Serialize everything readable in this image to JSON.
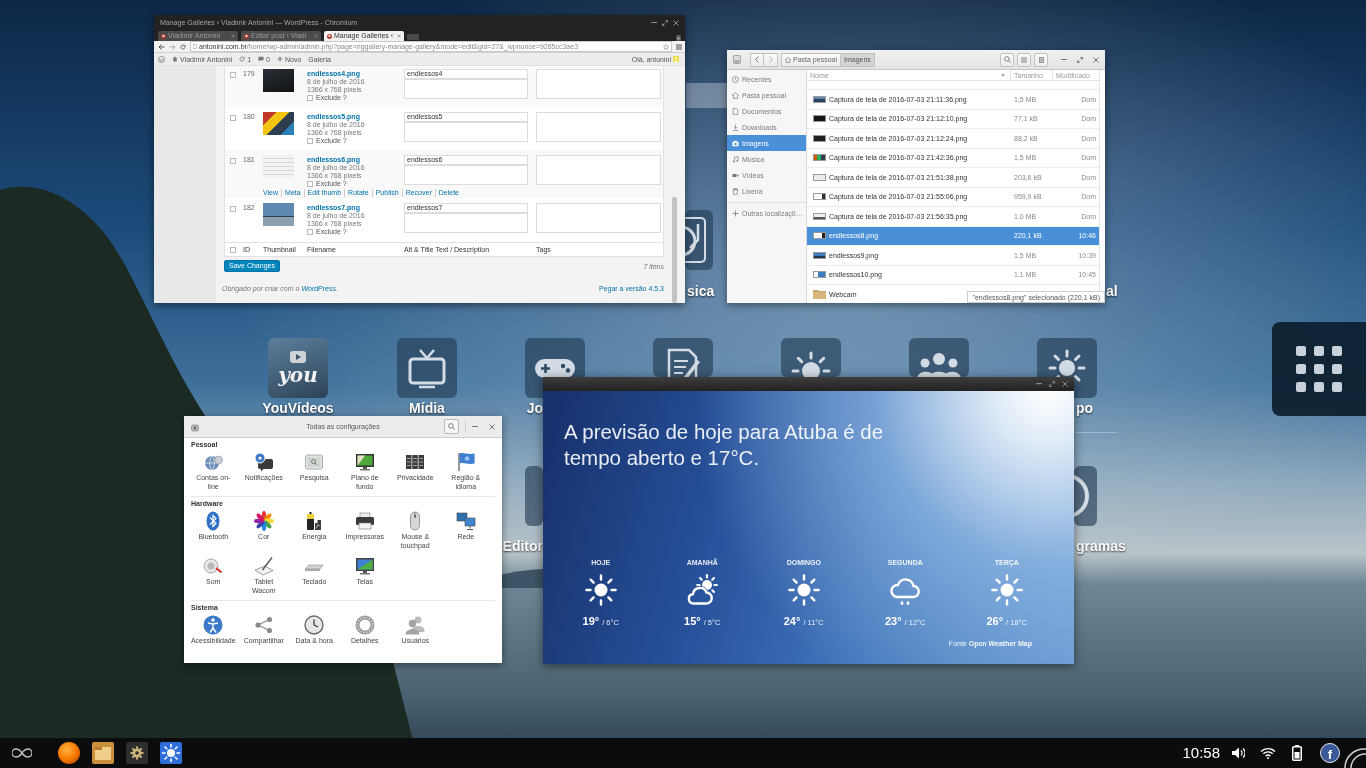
{
  "desktop": {
    "apps": [
      {
        "kind": "disc",
        "label": "sica"
      },
      {
        "kind": "hidden",
        "label": "al"
      },
      {
        "kind": "you",
        "logo": "you",
        "label": "YouVídeos"
      },
      {
        "kind": "tv",
        "label": "Mídia"
      },
      {
        "kind": "gamepad",
        "label": "Jo"
      },
      {
        "kind": "document"
      },
      {
        "kind": "bulb"
      },
      {
        "kind": "people"
      },
      {
        "kind": "sun",
        "label": "po"
      },
      {
        "kind": "blank",
        "label": "Editor"
      },
      {
        "kind": "ring",
        "label": "gramas"
      }
    ]
  },
  "browser": {
    "title": "Manage Galleries ‹ Vladimir Antonini — WordPress - Chromium",
    "tabs": [
      {
        "label": "Vladimir Antonini",
        "selected": false
      },
      {
        "label": "Editar post ‹ Vladi",
        "selected": false
      },
      {
        "label": "Manage Galleries ‹",
        "selected": true
      }
    ],
    "url_host": "antonini.com.br",
    "url_path": "/home/wp-admin/admin.php?page=nggallery-manage-gallery&mode=edit&gid=27&_wpnonce=9265cc3ae3",
    "admin_bar": [
      {
        "kind": "site",
        "label": "Vladimir Antonini"
      },
      {
        "kind": "updates",
        "label": "1"
      },
      {
        "kind": "comments",
        "label": "0"
      },
      {
        "kind": "new",
        "label": "Novo"
      },
      {
        "kind": "plain",
        "label": "Galeria"
      }
    ],
    "greeting": "Olá, antonini",
    "rows": [
      {
        "id": "179",
        "file": "endlessos4.png",
        "date": "8 de julho de 2016",
        "size": "1366 x 768 pixels",
        "exclude_label": "Exclude ?",
        "exclude": false,
        "checked": false,
        "alt": "endlessos4"
      },
      {
        "id": "180",
        "file": "endlessos5.png",
        "date": "8 de julho de 2016",
        "size": "1366 x 768 pixels",
        "exclude_label": "Exclude ?",
        "exclude": false,
        "checked": false,
        "alt": "endlessos5"
      },
      {
        "id": "181",
        "file": "endlessos6.png",
        "date": "8 de julho de 2016",
        "size": "1366 x 768 pixels",
        "exclude_label": "Exclude ?",
        "exclude": false,
        "checked": false,
        "alt": "endlessos6",
        "actions": [
          "View",
          "Meta",
          "Edit thumb",
          "Rotate",
          "Publish",
          "Recover",
          "Delete"
        ]
      },
      {
        "id": "182",
        "file": "endlessos7.png",
        "date": "8 de julho de 2016",
        "size": "1366 x 768 pixels",
        "exclude_label": "Exclude ?",
        "exclude": false,
        "checked": false,
        "alt": "endlessos7"
      }
    ],
    "header_checked": false,
    "columns": [
      "ID",
      "Thumbnail",
      "Filename",
      "Alt & Title Text / Description",
      "Tags"
    ],
    "save": "Save Changes",
    "count": "7 itens",
    "credit": {
      "text": "Obrigado por criar com o",
      "link": "WordPress",
      "end": "."
    },
    "version": "Pegar a versão 4.5.3"
  },
  "files": {
    "path": [
      {
        "kind": "home",
        "label": "Pasta pessoal",
        "selected": false
      },
      {
        "kind": "plain",
        "label": "Imagens",
        "selected": true
      }
    ],
    "places": [
      {
        "kind": "recent",
        "label": "Recentes",
        "selected": false
      },
      {
        "kind": "home",
        "label": "Pasta pessoal",
        "selected": false
      },
      {
        "kind": "documents",
        "label": "Documentos",
        "selected": false
      },
      {
        "kind": "downloads",
        "label": "Downloads",
        "selected": false
      },
      {
        "kind": "pictures",
        "label": "Imagens",
        "selected": true
      },
      {
        "kind": "music",
        "label": "Música",
        "selected": false
      },
      {
        "kind": "videos",
        "label": "Vídeos",
        "selected": false
      },
      {
        "kind": "trash",
        "label": "Lixeira",
        "selected": false
      },
      {
        "kind": "other",
        "label": "Outras localizaçõ…",
        "selected": false
      }
    ],
    "columns": [
      "Nome",
      "Tamanho",
      "Modificado"
    ],
    "rows": [
      {
        "kind": "image",
        "name": "Captura de tela de 2016-07-03 21:11:36.png",
        "size": "1,5 MB",
        "modified": "Dom",
        "selected": false
      },
      {
        "kind": "image",
        "name": "Captura de tela de 2016-07-03 21:12:10.png",
        "size": "77,1 kB",
        "modified": "Dom",
        "selected": false
      },
      {
        "kind": "image",
        "name": "Captura de tela de 2016-07-03 21:12:24.png",
        "size": "88,2 kB",
        "modified": "Dom",
        "selected": false
      },
      {
        "kind": "image",
        "name": "Captura de tela de 2016-07-03 21:42:36.png",
        "size": "1,5 MB",
        "modified": "Dom",
        "selected": false
      },
      {
        "kind": "image",
        "name": "Captura de tela de 2016-07-03 21:51:38.png",
        "size": "203,6 kB",
        "modified": "Dom",
        "selected": false
      },
      {
        "kind": "image",
        "name": "Captura de tela de 2016-07-03 21:55:06.png",
        "size": "959,9 kB",
        "modified": "Dom",
        "selected": false
      },
      {
        "kind": "image",
        "name": "Captura de tela de 2016-07-03 21:56:35.png",
        "size": "1,0 MB",
        "modified": "Dom",
        "selected": false
      },
      {
        "kind": "image",
        "name": "endlessos8.png",
        "size": "220,1 kB",
        "modified": "10:46",
        "selected": true
      },
      {
        "kind": "image",
        "name": "endlessos9.png",
        "size": "1,5 MB",
        "modified": "10:39",
        "selected": false
      },
      {
        "kind": "image",
        "name": "endlessos10.png",
        "size": "1,1 MB",
        "modified": "10:45",
        "selected": false
      },
      {
        "kind": "folder",
        "name": "Webcam",
        "selected": false
      }
    ],
    "status": "\"endlessos8.png\" selecionado (220,1 kB)"
  },
  "settings": {
    "title": "Todas as configurações",
    "sections": [
      {
        "title": "Pessoal",
        "items": [
          {
            "kind": "accounts",
            "label": "Contas on-\nline"
          },
          {
            "kind": "notifications",
            "label": "Notificações"
          },
          {
            "kind": "search",
            "label": "Pesquisa"
          },
          {
            "kind": "background",
            "label": "Plano de\nfundo"
          },
          {
            "kind": "privacy",
            "label": "Privacidade"
          },
          {
            "kind": "region",
            "label": "Região &\nidioma"
          }
        ]
      },
      {
        "title": "Hardware",
        "items": [
          {
            "kind": "bluetooth",
            "label": "Bluetooth"
          },
          {
            "kind": "color",
            "label": "Cor"
          },
          {
            "kind": "power",
            "label": "Energia"
          },
          {
            "kind": "printers",
            "label": "Impressoras"
          },
          {
            "kind": "mouse",
            "label": "Mouse &\ntouchpad"
          },
          {
            "kind": "network",
            "label": "Rede"
          },
          {
            "kind": "sound",
            "label": "Som"
          },
          {
            "kind": "tablet",
            "label": "Tablet\nWacom"
          },
          {
            "kind": "keyboard",
            "label": "Teclado"
          },
          {
            "kind": "displays",
            "label": "Telas"
          }
        ]
      },
      {
        "title": "Sistema",
        "items": [
          {
            "kind": "accessibility",
            "label": "Acessibilidade"
          },
          {
            "kind": "sharing",
            "label": "Compartilhar"
          },
          {
            "kind": "datetime",
            "label": "Data & hora"
          },
          {
            "kind": "details",
            "label": "Detalhes"
          },
          {
            "kind": "users",
            "label": "Usuários"
          }
        ]
      }
    ]
  },
  "weather": {
    "headline": "A previsão de hoje para Atuba é de tempo aberto e 17°C.",
    "days": [
      {
        "label": "HOJE",
        "kind": "sun",
        "high": "19°",
        "low": "/ 6°C"
      },
      {
        "label": "AMANHÃ",
        "kind": "partly-cloudy",
        "high": "15°",
        "low": "/ 5°C"
      },
      {
        "label": "DOMINGO",
        "kind": "sun",
        "high": "24°",
        "low": "/ 11°C"
      },
      {
        "label": "SEGUNDA",
        "kind": "rain",
        "high": "23°",
        "low": "/ 12°C"
      },
      {
        "label": "TERÇA",
        "kind": "sun",
        "high": "26°",
        "low": "/ 18°C"
      }
    ],
    "source": "Fonte **Open Weather Map**"
  },
  "taskbar": {
    "clock": "10:58",
    "social": "f"
  }
}
